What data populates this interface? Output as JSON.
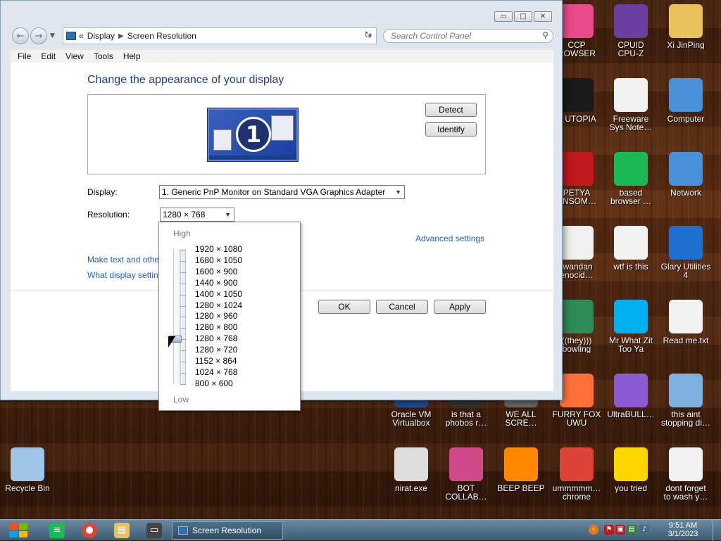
{
  "window": {
    "controls": [
      "▭",
      "□",
      "✕"
    ],
    "address": {
      "prefix": "«",
      "crumb1": "Display",
      "crumb2": "Screen Resolution"
    },
    "search_placeholder": "Search Control Panel",
    "menu": [
      "File",
      "Edit",
      "View",
      "Tools",
      "Help"
    ]
  },
  "content": {
    "heading": "Change the appearance of your display",
    "monitor_number": "1",
    "detect_label": "Detect",
    "identify_label": "Identify",
    "display_label": "Display:",
    "display_value": "1. Generic PnP Monitor on Standard VGA Graphics Adapter",
    "resolution_label": "Resolution:",
    "resolution_value": "1280 × 768",
    "advanced_link": "Advanced settings",
    "link1": "Make text and othe",
    "link2": "What display settin",
    "ok_label": "OK",
    "cancel_label": "Cancel",
    "apply_label": "Apply"
  },
  "dropdown": {
    "high_label": "High",
    "low_label": "Low",
    "options": [
      "1920 × 1080",
      "1680 × 1050",
      "1600 × 900",
      "1440 × 900",
      "1400 × 1050",
      "1280 × 1024",
      "1280 × 960",
      "1280 × 800",
      "1280 × 768",
      "1280 × 720",
      "1152 × 864",
      "1024 × 768",
      "800 × 600"
    ],
    "selected_index": 8
  },
  "desktop": {
    "icons": [
      {
        "label": "CCP\nROWSER",
        "icon": "browser-icon",
        "color": "#e84a8a"
      },
      {
        "label": "CPUID\nCPU-Z",
        "icon": "cpuz-icon",
        "color": "#6a3fa0"
      },
      {
        "label": "Xi JinPing",
        "icon": "user-folder-icon",
        "color": "#e8c25a"
      },
      {
        "label": "P UTOPIA",
        "icon": "utopia-icon",
        "color": "#1a1a1a"
      },
      {
        "label": "Freeware\nSys Note…",
        "icon": "document-icon",
        "color": "#f2f2f2"
      },
      {
        "label": "Computer",
        "icon": "computer-icon",
        "color": "#4a90d9"
      },
      {
        "label": "PETYA\nANSOM…",
        "icon": "skull-icon",
        "color": "#c0181c"
      },
      {
        "label": "based\nbrowser …",
        "icon": "browser-icon",
        "color": "#1db954"
      },
      {
        "label": "Network",
        "icon": "network-icon",
        "color": "#4a90d9"
      },
      {
        "label": ".wandan\nenocid…",
        "icon": "meme-icon",
        "color": "#f0f0f0"
      },
      {
        "label": "wtf is this",
        "icon": "document-icon",
        "color": "#f2f2f2"
      },
      {
        "label": "Glary Utilities\n4",
        "icon": "glary-icon",
        "color": "#1e6fd0"
      },
      {
        "label": "((they)))\nbowling",
        "icon": "meme-icon",
        "color": "#2e8b57"
      },
      {
        "label": "Mr What Zit\nToo Ya",
        "icon": "skype-icon",
        "color": "#00aff0"
      },
      {
        "label": "Read me.txt",
        "icon": "text-file-icon",
        "color": "#f2f2f2"
      },
      {
        "label": "Oracle VM\nVirtualbox",
        "icon": "virtualbox-icon",
        "color": "#1d4f91"
      },
      {
        "label": "is that a\nphobos r…",
        "icon": "app-icon",
        "color": "#333"
      },
      {
        "label": "WE ALL\nSCRE…",
        "icon": "app-icon",
        "color": "#666"
      },
      {
        "label": "FURRY FOX\nUWU",
        "icon": "firefox-icon",
        "color": "#ff7139"
      },
      {
        "label": "UltraBULL…",
        "icon": "disc-icon",
        "color": "#8a5bd1"
      },
      {
        "label": "this aint\nstopping di…",
        "icon": "installer-icon",
        "color": "#7fb0e0"
      },
      {
        "label": "Recycle Bin",
        "icon": "recycle-bin-icon",
        "color": "#9fc4e8"
      },
      {
        "label": "nirat.exe",
        "icon": "skull-icon",
        "color": "#ddd"
      },
      {
        "label": "BOT\nCOLLAB…",
        "icon": "monitor-icon",
        "color": "#d04a8a"
      },
      {
        "label": "BEEP BEEP",
        "icon": "vlc-icon",
        "color": "#ff8800"
      },
      {
        "label": "ummmmm…\nchrome",
        "icon": "chrome-icon",
        "color": "#db4437"
      },
      {
        "label": "you tried",
        "icon": "star-icon",
        "color": "#ffd700"
      },
      {
        "label": "dont forget\nto wash y…",
        "icon": "document-icon",
        "color": "#f2f2f2"
      }
    ]
  },
  "taskbar": {
    "task_label": "Screen Resolution",
    "time": "9:51 AM",
    "date": "3/1/2023"
  }
}
